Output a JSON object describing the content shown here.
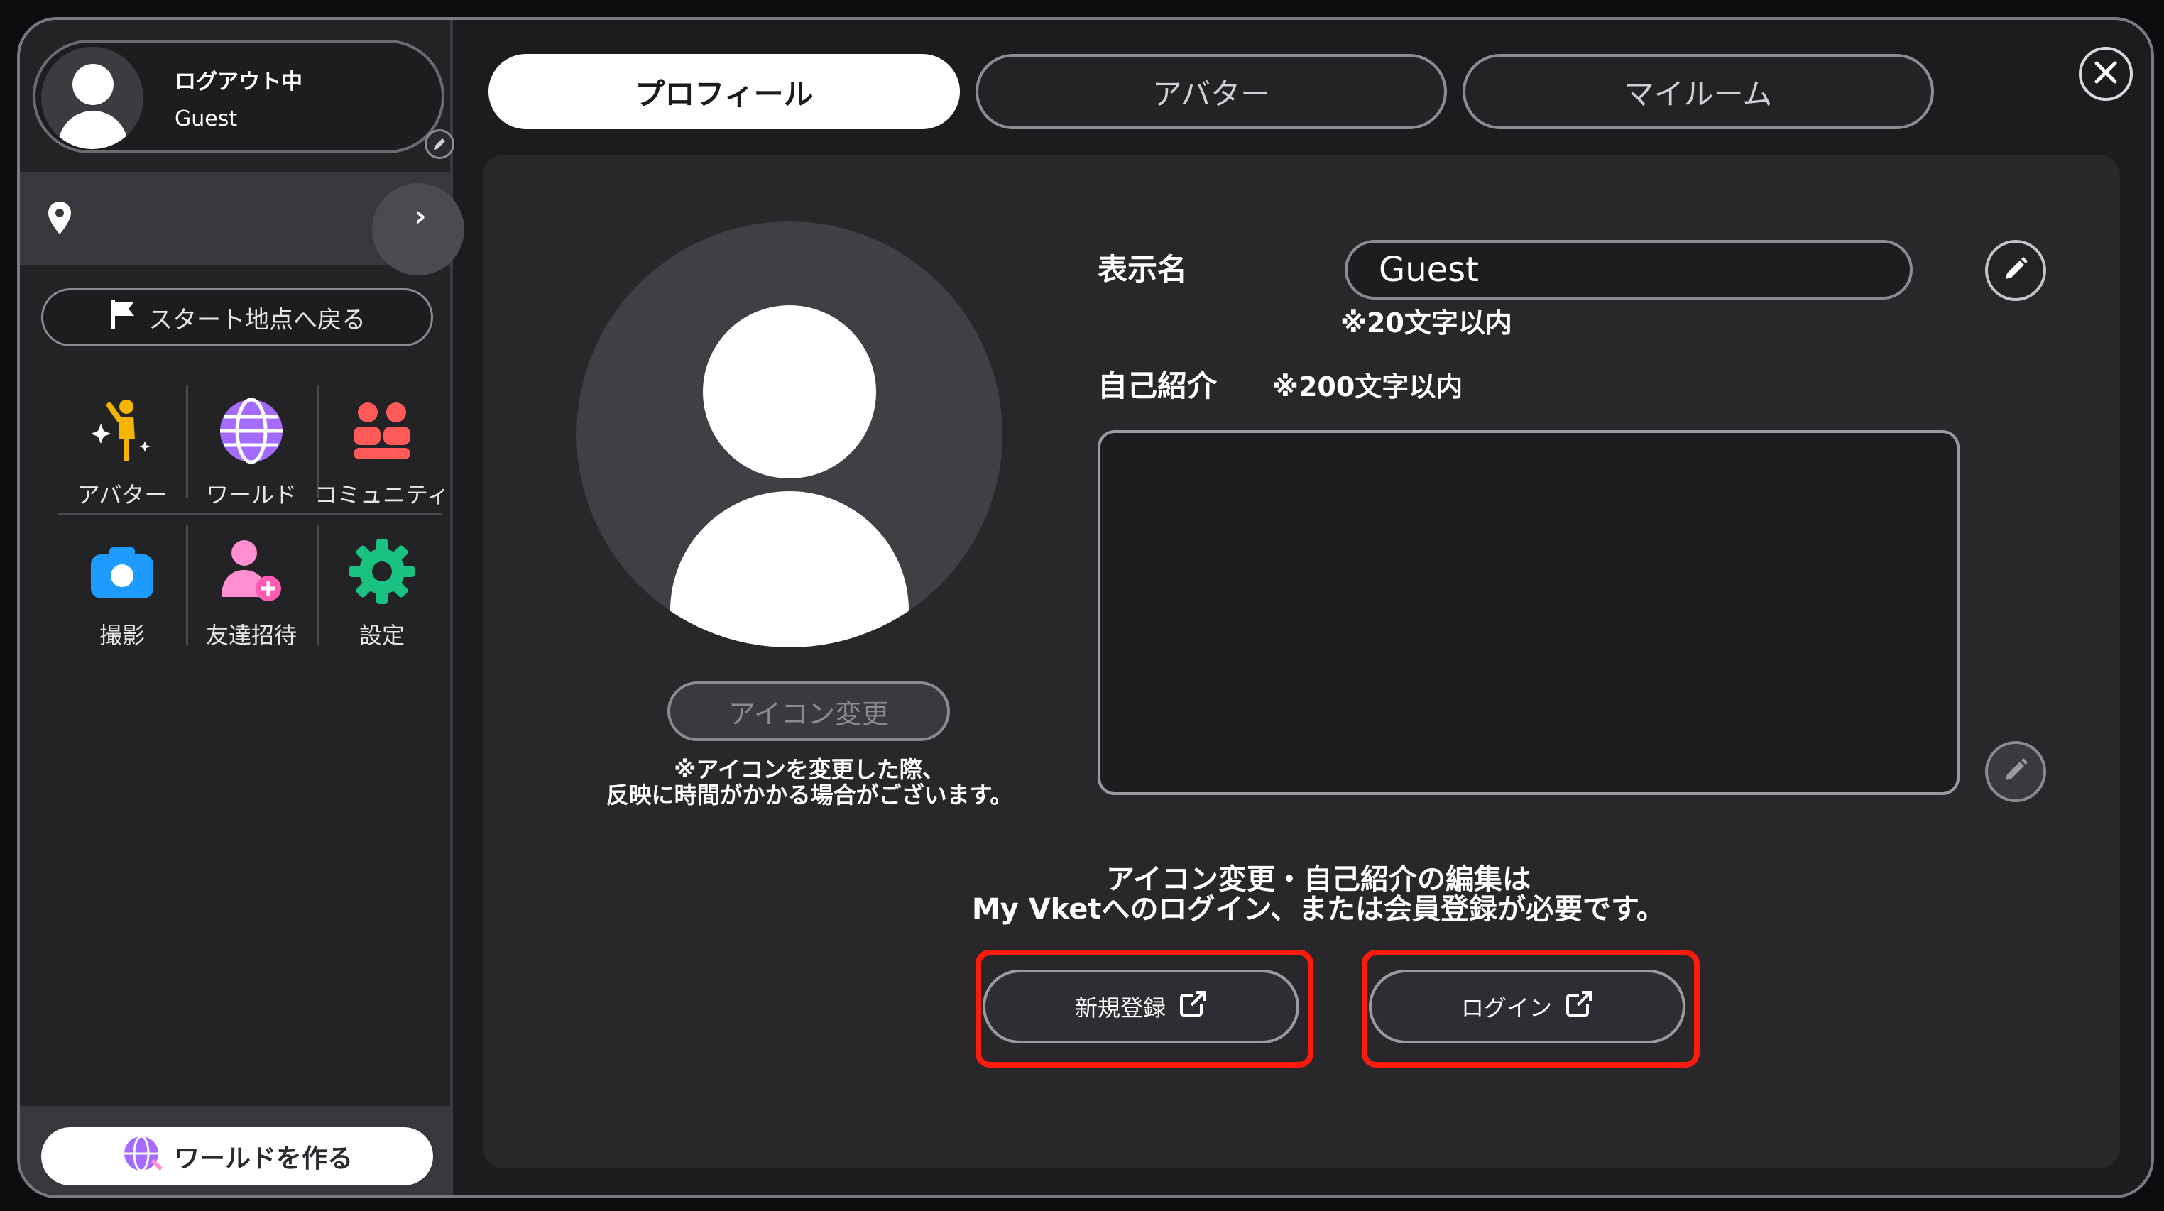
{
  "user": {
    "status": "ログアウト中",
    "name": "Guest"
  },
  "sidebar": {
    "start_button_label": "スタート地点へ戻る",
    "menu": [
      {
        "label": "アバター",
        "icon": "avatar-sparkle-icon",
        "color": "#f5b400"
      },
      {
        "label": "ワールド",
        "icon": "globe-icon",
        "color": "#a46bff"
      },
      {
        "label": "コミュニティ",
        "icon": "community-icon",
        "color": "#ff5a5a"
      },
      {
        "label": "撮影",
        "icon": "camera-icon",
        "color": "#1e9bff"
      },
      {
        "label": "友達招待",
        "icon": "invite-friend-icon",
        "color": "#ff8fd0"
      },
      {
        "label": "設定",
        "icon": "gear-icon",
        "color": "#19c280"
      }
    ],
    "create_world_label": "ワールドを作る"
  },
  "tabs": [
    {
      "label": "プロフィール",
      "active": true
    },
    {
      "label": "アバター",
      "active": false
    },
    {
      "label": "マイルーム",
      "active": false
    }
  ],
  "profile": {
    "icon_change_label": "アイコン変更",
    "icon_note_line1": "※アイコンを変更した際、",
    "icon_note_line2": "反映に時間がかかる場合がございます。",
    "display_name_label": "表示名",
    "display_name_value": "Guest",
    "display_name_note": "※20文字以内",
    "bio_label": "自己紹介",
    "bio_note": "※200文字以内",
    "bio_value": "",
    "login_note_line1": "アイコン変更・自己紹介の編集は",
    "login_note_line2": "My Vketへのログイン、または会員登録が必要です。",
    "register_label": "新規登録",
    "login_label": "ログイン"
  },
  "colors": {
    "highlight_frame": "#ff1a0e",
    "panel": "#28282b",
    "sidebar": "#232326"
  }
}
